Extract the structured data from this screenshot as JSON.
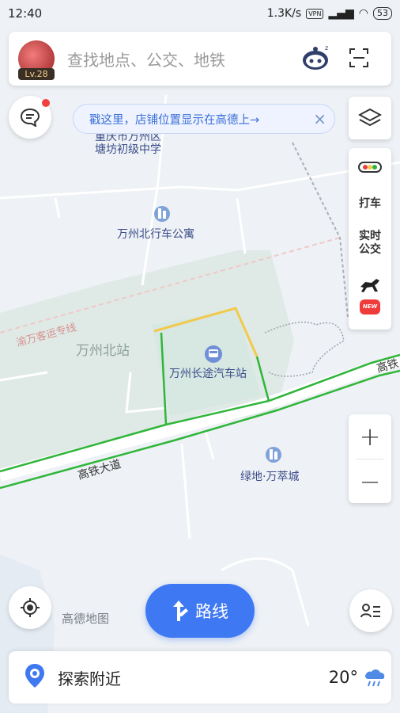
{
  "status_bar": {
    "time": "12:40",
    "speed": "1.3K/s",
    "vpn": "VPN",
    "battery": "53"
  },
  "search": {
    "placeholder": "查找地点、公交、地铁",
    "level": "Lv.28"
  },
  "tip_banner": {
    "text": "戳这里，店铺位置显示在高德上→"
  },
  "side_tools": {
    "taxi": "打车",
    "realtime_bus_1": "实时",
    "realtime_bus_2": "公交",
    "new_badge": "NEW"
  },
  "map_labels": {
    "school_1": "重庆市万州区",
    "school_2": "塘坊初级中学",
    "apartment": "万州北行车公寓",
    "rail_line": "渝万客运专线",
    "station": "万州北站",
    "bus_station": "万州长途汽车站",
    "road_main": "高铁大道",
    "road_edge": "高铁",
    "community": "绿地·万萃城"
  },
  "brand": "高德地图",
  "route_button": "路线",
  "explore": "探索附近",
  "weather": {
    "temperature": "20°"
  },
  "colors": {
    "accent": "#3e78f2",
    "route_green": "#2fb63a",
    "route_yellow": "#f2c94c",
    "map_bg": "#eef1f5",
    "station_area": "#dfeae6"
  }
}
